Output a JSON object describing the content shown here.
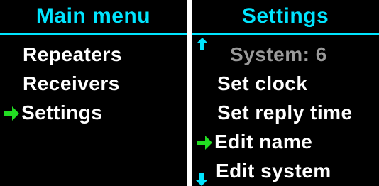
{
  "main_menu": {
    "title": "Main menu",
    "items": [
      {
        "label": "Repeaters"
      },
      {
        "label": "Receivers"
      },
      {
        "label": "Settings"
      }
    ],
    "selected_index": 2
  },
  "settings_menu": {
    "title": "Settings",
    "items": [
      {
        "label": "System: 6",
        "state": "disabled"
      },
      {
        "label": "Set clock"
      },
      {
        "label": "Set reply time"
      },
      {
        "label": "Edit name"
      },
      {
        "label": "Edit system"
      }
    ],
    "selected_index": 3,
    "scroll_up": true,
    "scroll_down": true
  },
  "icons": {
    "cursor": "arrow-right-icon",
    "scroll_up": "arrow-up-icon",
    "scroll_down": "arrow-down-icon"
  },
  "colors": {
    "background": "#000000",
    "title": "#00e5ff",
    "item": "#ffffff",
    "disabled_item": "#9a9a9a",
    "cursor": "#22dd22",
    "scroll_arrow": "#00e5ff"
  }
}
